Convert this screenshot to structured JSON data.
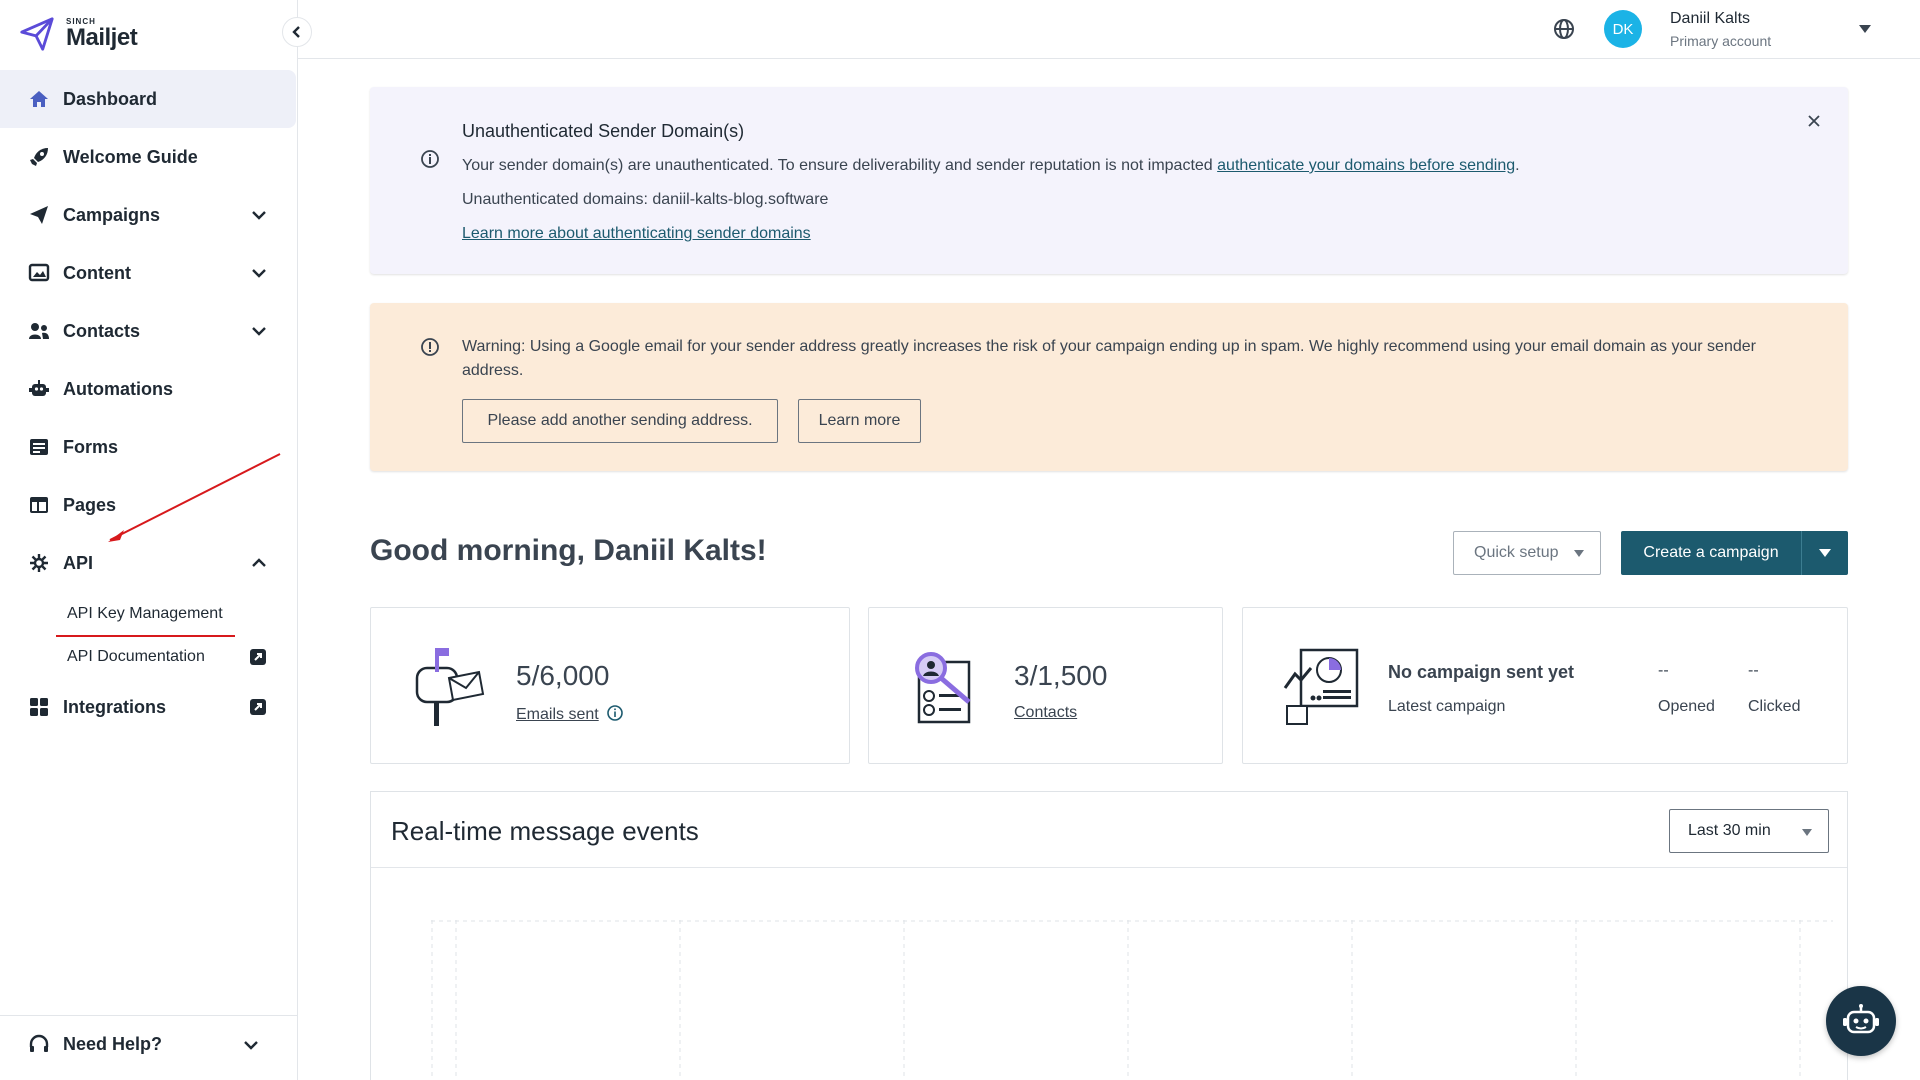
{
  "brand": {
    "small": "SINCH",
    "name": "Mailjet"
  },
  "sidebar": {
    "items": [
      {
        "label": "Dashboard"
      },
      {
        "label": "Welcome Guide"
      },
      {
        "label": "Campaigns"
      },
      {
        "label": "Content"
      },
      {
        "label": "Contacts"
      },
      {
        "label": "Automations"
      },
      {
        "label": "Forms"
      },
      {
        "label": "Pages"
      },
      {
        "label": "API"
      },
      {
        "label": "Integrations"
      }
    ],
    "api_sub": [
      {
        "label": "API Key Management"
      },
      {
        "label": "API Documentation"
      }
    ],
    "help_label": "Need Help?"
  },
  "header": {
    "avatar_initials": "DK",
    "user_name": "Daniil Kalts",
    "user_sub": "Primary account"
  },
  "banner_info": {
    "title": "Unauthenticated Sender Domain(s)",
    "line1_text": "Your sender domain(s) are unauthenticated. To ensure deliverability and sender reputation is not impacted ",
    "line1_link": "authenticate your domains before sending",
    "line1_end": ".",
    "line2": "Unauthenticated domains: daniil-kalts-blog.software",
    "line3_link": "Learn more about authenticating sender domains"
  },
  "banner_warn": {
    "text": "Warning: Using a Google email for your sender address greatly increases the risk of your campaign ending up in spam. We highly recommend using your email domain as your sender address.",
    "btn_add": "Please add another sending address.",
    "btn_learn": "Learn more"
  },
  "dashboard": {
    "greeting": "Good morning, Daniil Kalts!",
    "quick_setup": "Quick setup",
    "create_campaign": "Create a campaign"
  },
  "cards": {
    "emails": {
      "value": "5/6,000",
      "label": "Emails sent"
    },
    "contacts": {
      "value": "3/1,500",
      "label": "Contacts"
    },
    "campaign": {
      "title": "No campaign sent yet",
      "sub": "Latest campaign",
      "opened_value": "--",
      "opened_label": "Opened",
      "clicked_value": "--",
      "clicked_label": "Clicked"
    }
  },
  "realtime": {
    "title": "Real-time message events",
    "range": "Last 30 min"
  },
  "colors": {
    "accent": "#1c5a6e",
    "avatar": "#1bb3e6",
    "info_bg": "#f4f3fc",
    "warn_bg": "#fcebd9",
    "annotation": "#d7191c"
  }
}
